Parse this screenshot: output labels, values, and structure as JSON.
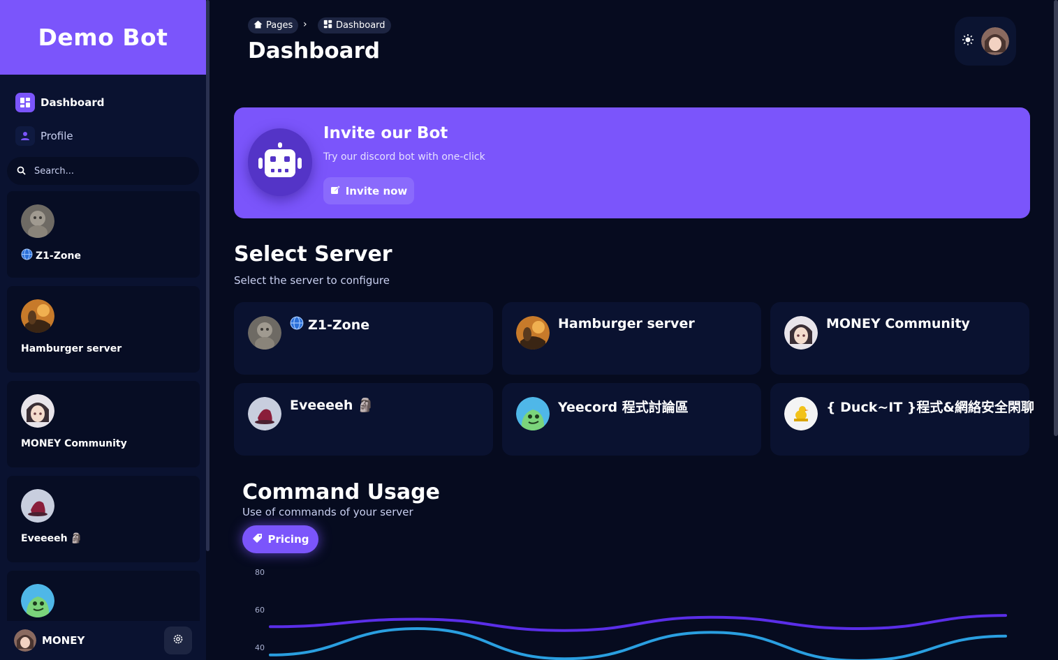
{
  "app": {
    "brand": "Demo Bot"
  },
  "sidebar": {
    "nav": [
      {
        "label": "Dashboard",
        "icon": "dashboard-icon",
        "active": true
      },
      {
        "label": "Profile",
        "icon": "person-icon",
        "active": false
      }
    ],
    "search": {
      "placeholder": "Search..."
    },
    "servers": [
      {
        "name": "Z1-Zone",
        "prefix_icon": "globe-icon",
        "avatar": "photo-gray"
      },
      {
        "name": "Hamburger server",
        "avatar": "photo-orange"
      },
      {
        "name": "MONEY Community",
        "avatar": "anime-girl"
      },
      {
        "name": "Eveeeeh",
        "suffix": "🗿",
        "avatar": "shoe-photo"
      },
      {
        "name": "",
        "avatar": "green-dino"
      }
    ],
    "user": {
      "name": "MONEY"
    }
  },
  "header": {
    "breadcrumb": [
      {
        "label": "Pages",
        "icon": "home-icon"
      },
      {
        "label": "Dashboard",
        "icon": "dashboard-icon"
      }
    ],
    "title": "Dashboard"
  },
  "invite": {
    "title": "Invite our Bot",
    "description": "Try our discord bot with one-click",
    "button": "Invite now"
  },
  "select_server": {
    "title": "Select Server",
    "subtitle": "Select the server to configure",
    "servers": [
      {
        "name": "Z1-Zone",
        "prefix_icon": "globe-icon",
        "avatar": "photo-gray"
      },
      {
        "name": "Hamburger server",
        "avatar": "photo-orange"
      },
      {
        "name": "MONEY Community",
        "avatar": "anime-girl"
      },
      {
        "name": "Eveeeeh",
        "suffix": "🗿",
        "avatar": "shoe-photo"
      },
      {
        "name": "Yeecord 程式討論區",
        "avatar": "green-dino"
      },
      {
        "name": "{ Duck~IT }程式&網絡安全閑聊",
        "avatar": "duck-logo"
      }
    ]
  },
  "command_usage": {
    "title": "Command Usage",
    "subtitle": "Use of commands of your server",
    "button": "Pricing"
  },
  "colors": {
    "accent": "#7b55fb",
    "background": "#060b1f",
    "card": "#0a1230",
    "series_purple": "#5a2ee8",
    "series_blue": "#2a9fe0"
  },
  "chart_data": {
    "type": "line",
    "y_ticks": [
      80,
      60,
      40
    ],
    "ylim": [
      40,
      80
    ],
    "series": [
      {
        "values": [
          51,
          55,
          49,
          56,
          50,
          57
        ]
      },
      {
        "values": [
          36,
          50,
          34,
          48,
          33,
          46
        ]
      }
    ],
    "grid": false
  }
}
